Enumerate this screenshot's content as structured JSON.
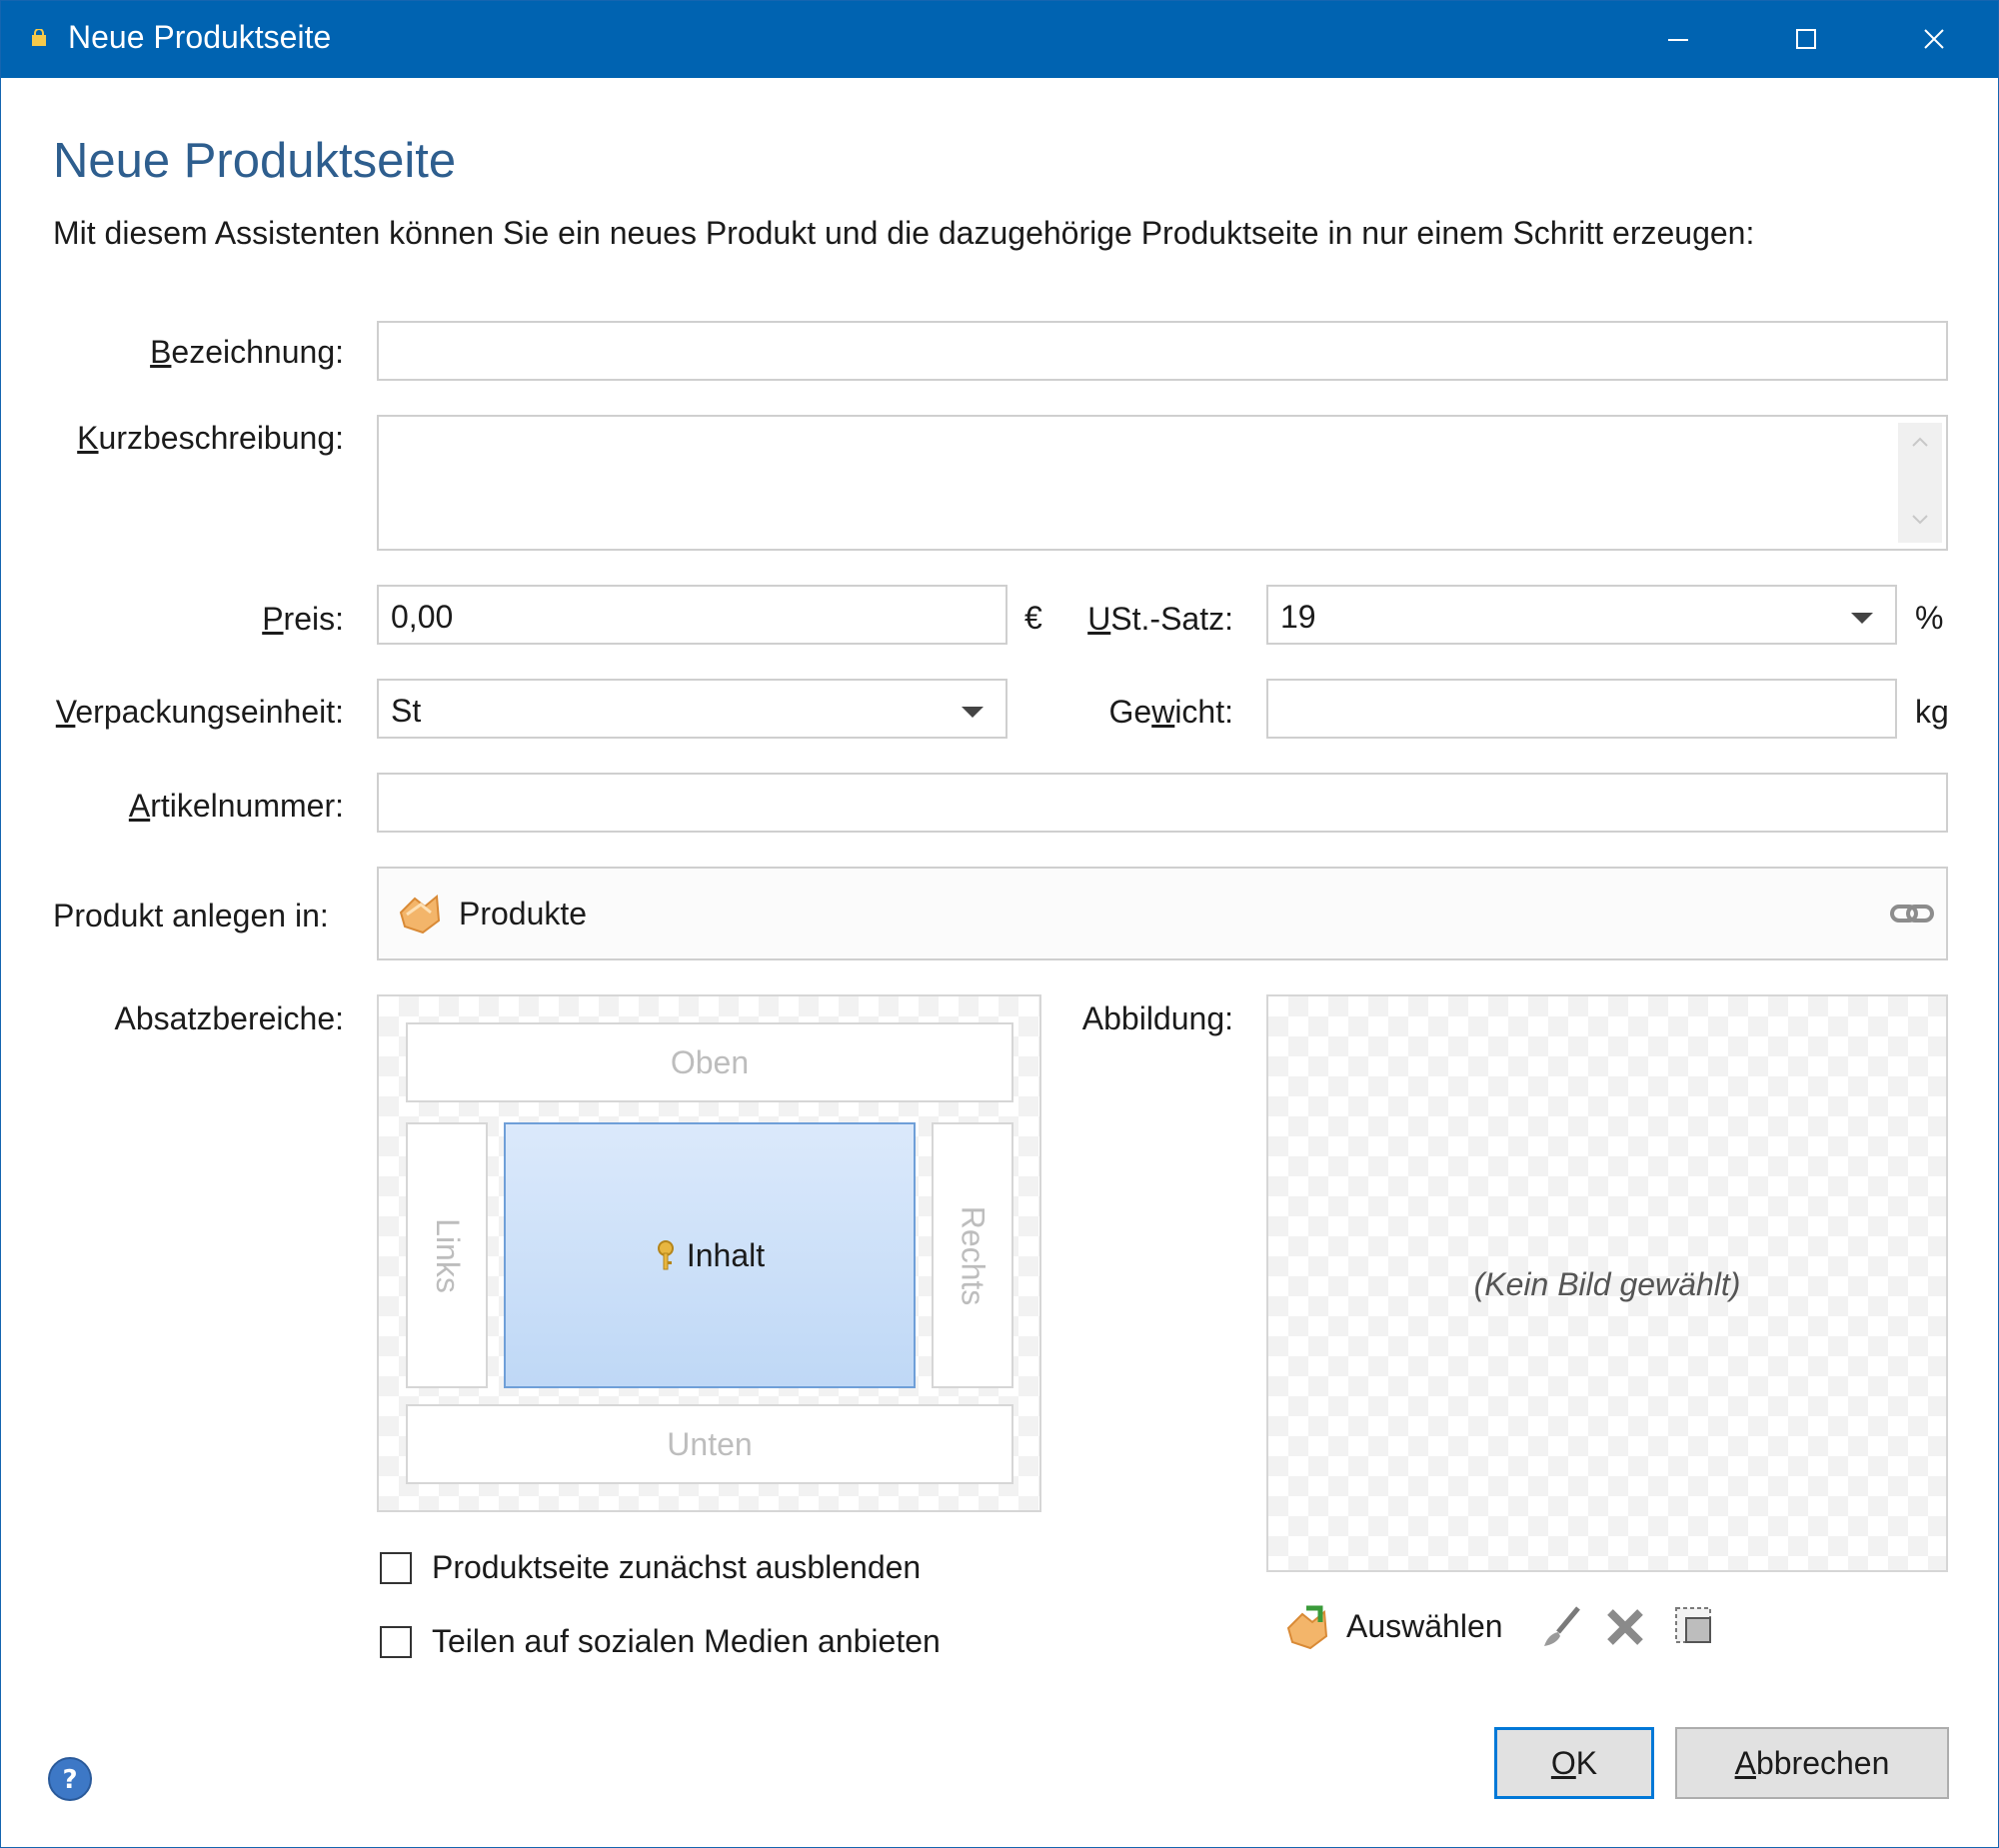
{
  "window": {
    "title": "Neue Produktseite"
  },
  "heading": "Neue Produktseite",
  "intro": "Mit diesem Assistenten können Sie ein neues Produkt und die dazugehörige Produktseite in nur einem Schritt erzeugen:",
  "fields": {
    "bezeichnung": {
      "label_u": "B",
      "label_rest": "ezeichnung:",
      "value": ""
    },
    "kurzbeschreibung": {
      "label_u": "K",
      "label_rest": "urzbeschreibung:",
      "value": ""
    },
    "preis": {
      "label_u": "P",
      "label_rest": "reis:",
      "value": "0,00",
      "unit": "€"
    },
    "ust": {
      "label_u": "U",
      "label_rest": "St.-Satz:",
      "value": "19",
      "unit": "%"
    },
    "verpackung": {
      "label_u": "V",
      "label_rest": "erpackungseinheit:",
      "value": "St"
    },
    "gewicht": {
      "label_pre": "Ge",
      "label_u": "w",
      "label_rest": "icht:",
      "value": "",
      "unit": "kg"
    },
    "artikelnummer": {
      "label_u": "A",
      "label_rest": "rtikelnummer:",
      "value": ""
    },
    "anlegen": {
      "label": "Produkt anlegen in:",
      "value": "Produkte"
    }
  },
  "absatz": {
    "label": "Absatzbereiche:",
    "oben": "Oben",
    "links": "Links",
    "inhalt": "Inhalt",
    "rechts": "Rechts",
    "unten": "Unten"
  },
  "abbildung": {
    "label": "Abbildung:",
    "placeholder": "(Kein Bild gewählt)",
    "select_label": "Auswählen"
  },
  "checkboxes": [
    {
      "label": "Produktseite zunächst ausblenden",
      "checked": false
    },
    {
      "label": "Teilen auf sozialen Medien anbieten",
      "checked": false
    }
  ],
  "buttons": {
    "ok_u": "O",
    "ok_rest": "K",
    "cancel_u": "A",
    "cancel_rest": "bbrechen"
  },
  "colors": {
    "titlebar": "#0063b1",
    "heading": "#2e5e8e",
    "content_area": "#cfe1f8"
  }
}
